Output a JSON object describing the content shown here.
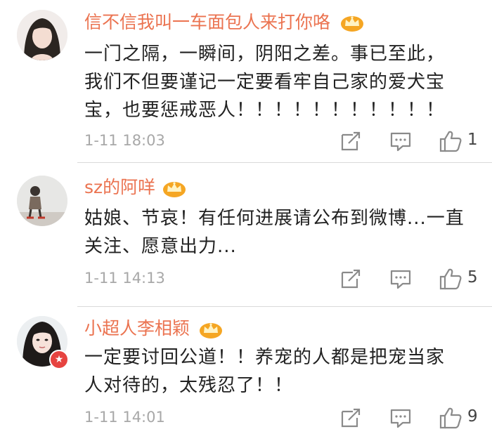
{
  "comments": [
    {
      "username": "信不信我叫一车面包人来打你咯",
      "lines": [
        "一门之隔，一瞬间，阴阳之差。事已至此，",
        "我们不但要谨记一定要看牢自己家的爱犬宝",
        "宝，也要惩戒恶人！！！！！！！！！！！"
      ],
      "time": "1-11 18:03",
      "likes": "1"
    },
    {
      "username": "sz的阿咩",
      "lines": [
        "姑娘、节哀！有任何进展请公布到微博...一直",
        "关注、愿意出力..."
      ],
      "time": "1-11 14:13",
      "likes": "5"
    },
    {
      "username": "小超人李相颖",
      "lines": [
        "一定要讨回公道！！养宠的人都是把宠当家",
        "人对待的，太残忍了！！"
      ],
      "time": "1-11 14:01",
      "likes": "9"
    }
  ],
  "colors": {
    "username": "#eb7350",
    "crown": "#f5a623",
    "text": "#222222",
    "meta": "#a8a8a8"
  }
}
